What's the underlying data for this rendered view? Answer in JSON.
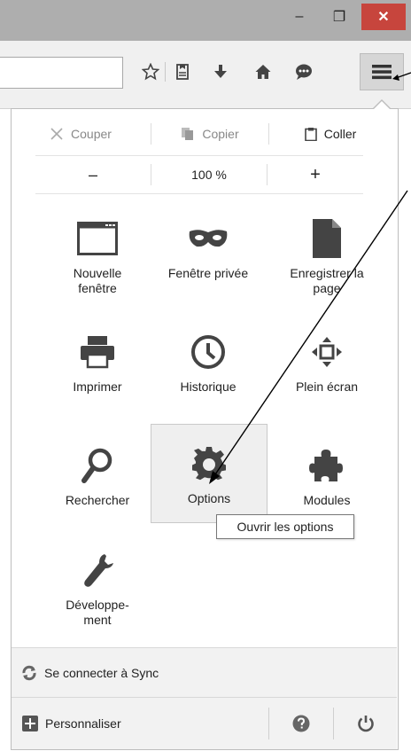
{
  "window": {
    "minimize_glyph": "–",
    "maximize_glyph": "❐",
    "close_glyph": "✕",
    "close_color": "#c7453d"
  },
  "toolbar": {
    "icons": [
      "star-icon",
      "reading-list-icon",
      "download-icon",
      "home-icon",
      "chat-icon",
      "menu-icon"
    ]
  },
  "edit": {
    "cut": "Couper",
    "copy": "Copier",
    "paste": "Coller"
  },
  "zoom": {
    "minus": "–",
    "level": "100 %",
    "plus": "+"
  },
  "tiles": {
    "new_window": [
      "Nouvelle",
      "fenêtre"
    ],
    "private_window": "Fenêtre privée",
    "save_page": [
      "Enregistrer la",
      "page"
    ],
    "print": "Imprimer",
    "history": "Historique",
    "fullscreen": "Plein écran",
    "find": "Rechercher",
    "options": "Options",
    "addons": "Modules",
    "developer": [
      "Développe-",
      "ment"
    ]
  },
  "tooltip": "Ouvrir les options",
  "footer": {
    "sync": "Se connecter à Sync",
    "customize": "Personnaliser"
  }
}
